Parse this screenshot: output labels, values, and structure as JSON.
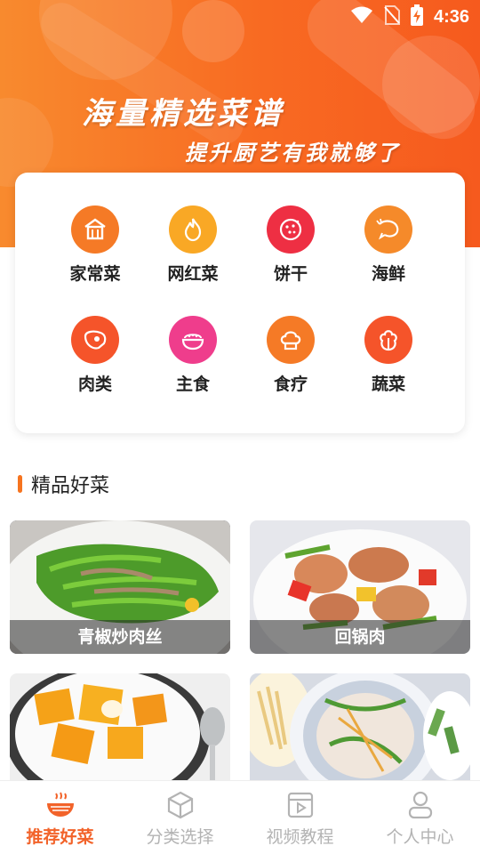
{
  "status_bar": {
    "time": "4:36"
  },
  "banner": {
    "title": "海量精选菜谱",
    "subtitle": "提升厨艺有我就够了"
  },
  "categories": [
    {
      "label": "家常菜",
      "icon": "house-icon",
      "color": "#f57a26"
    },
    {
      "label": "网红菜",
      "icon": "flame-icon",
      "color": "#f9a825"
    },
    {
      "label": "饼干",
      "icon": "cookie-icon",
      "color": "#ee2f43"
    },
    {
      "label": "海鲜",
      "icon": "shrimp-icon",
      "color": "#f58a2a"
    },
    {
      "label": "肉类",
      "icon": "meat-icon",
      "color": "#f5542a"
    },
    {
      "label": "主食",
      "icon": "rice-bowl-icon",
      "color": "#ef3d8c"
    },
    {
      "label": "食疗",
      "icon": "chef-hat-icon",
      "color": "#f57a26"
    },
    {
      "label": "蔬菜",
      "icon": "vegetable-icon",
      "color": "#f5542a"
    }
  ],
  "section": {
    "title": "精品好菜"
  },
  "dishes": [
    {
      "name": "青椒炒肉丝"
    },
    {
      "name": "回锅肉"
    },
    {
      "name": ""
    },
    {
      "name": ""
    }
  ],
  "nav": [
    {
      "label": "推荐好菜",
      "icon": "noodle-bowl-icon",
      "active": true
    },
    {
      "label": "分类选择",
      "icon": "cube-icon",
      "active": false
    },
    {
      "label": "视频教程",
      "icon": "video-icon",
      "active": false
    },
    {
      "label": "个人中心",
      "icon": "person-icon",
      "active": false
    }
  ],
  "colors": {
    "accent": "#f6741f",
    "nav_active": "#f2632a",
    "nav_inactive": "#b3b3b3"
  }
}
